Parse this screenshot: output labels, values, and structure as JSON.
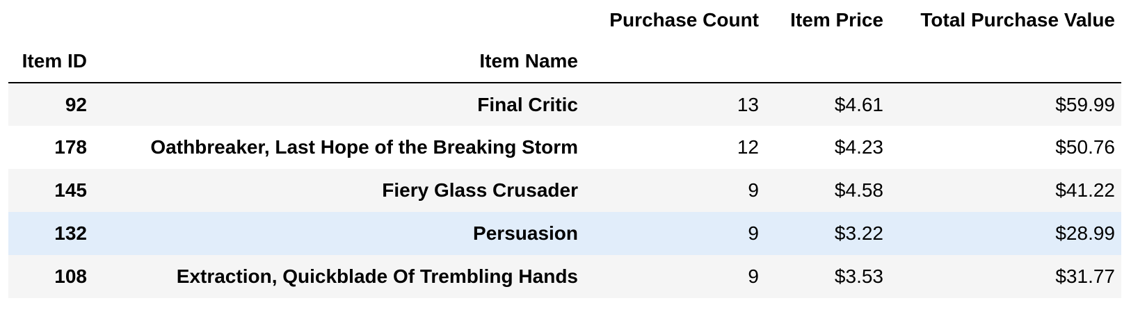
{
  "table": {
    "columns": [
      "Purchase Count",
      "Item Price",
      "Total Purchase Value"
    ],
    "index_names": [
      "Item ID",
      "Item Name"
    ],
    "rows": [
      {
        "item_id": "92",
        "item_name": "Final Critic",
        "purchase_count": "13",
        "item_price": "$4.61",
        "total_purchase_value": "$59.99"
      },
      {
        "item_id": "178",
        "item_name": "Oathbreaker, Last Hope of the Breaking Storm",
        "purchase_count": "12",
        "item_price": "$4.23",
        "total_purchase_value": "$50.76"
      },
      {
        "item_id": "145",
        "item_name": "Fiery Glass Crusader",
        "purchase_count": "9",
        "item_price": "$4.58",
        "total_purchase_value": "$41.22"
      },
      {
        "item_id": "132",
        "item_name": "Persuasion",
        "purchase_count": "9",
        "item_price": "$3.22",
        "total_purchase_value": "$28.99"
      },
      {
        "item_id": "108",
        "item_name": "Extraction, Quickblade Of Trembling Hands",
        "purchase_count": "9",
        "item_price": "$3.53",
        "total_purchase_value": "$31.77"
      }
    ]
  },
  "colors": {
    "row_stripe": "#f5f5f5",
    "row_hover": "#e1edfa",
    "header_rule": "#000000"
  }
}
